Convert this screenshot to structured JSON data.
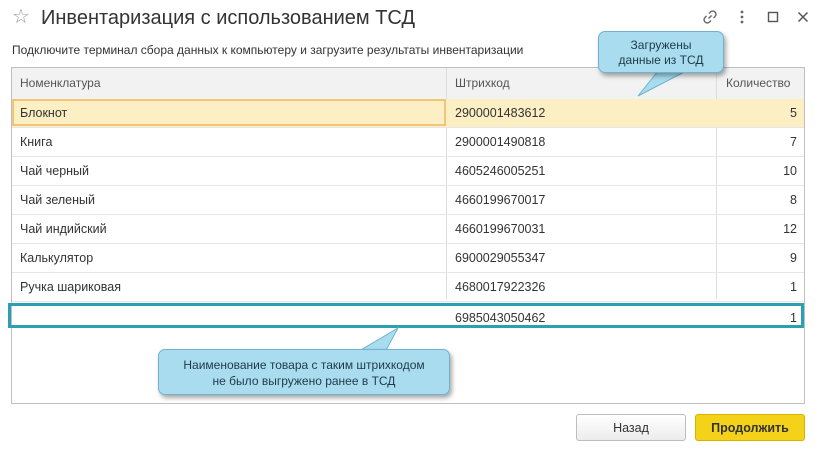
{
  "window": {
    "title": "Инвентаризация с использованием ТСД",
    "icons": [
      "star-icon",
      "link-icon",
      "more-icon",
      "maximize-icon",
      "close-icon"
    ]
  },
  "instruction": "Подключите терминал сбора данных к компьютеру и загрузите  результаты инвентаризации",
  "table": {
    "headers": {
      "name": "Номенклатура",
      "barcode": "Штрихкод",
      "qty": "Количество"
    },
    "rows": [
      {
        "name": "Блокнот",
        "barcode": "2900001483612",
        "qty": "5"
      },
      {
        "name": "Книга",
        "barcode": "2900001490818",
        "qty": "7"
      },
      {
        "name": "Чай черный",
        "barcode": "4605246005251",
        "qty": "10"
      },
      {
        "name": "Чай зеленый",
        "barcode": "4660199670017",
        "qty": "8"
      },
      {
        "name": "Чай индийский",
        "barcode": "4660199670031",
        "qty": "12"
      },
      {
        "name": "Калькулятор",
        "barcode": "6900029055347",
        "qty": "9"
      },
      {
        "name": "Ручка шариковая",
        "barcode": "4680017922326",
        "qty": "1"
      },
      {
        "name": "",
        "barcode": "6985043050462",
        "qty": "1"
      }
    ],
    "selected_row": 0,
    "highlighted_row": 7
  },
  "callouts": {
    "loaded_line1": "Загружены",
    "loaded_line2": "данные из ТСД",
    "unknown_line1": "Наименование товара с таким штрихкодом",
    "unknown_line2": "не было выгружено ранее в ТСД"
  },
  "buttons": {
    "back": "Назад",
    "next": "Продолжить"
  },
  "colors": {
    "selected_row": "#fcefc4",
    "highlight_border": "#2aa0b2",
    "callout": "#a9dcee",
    "primary_button": "#f5d21a"
  }
}
